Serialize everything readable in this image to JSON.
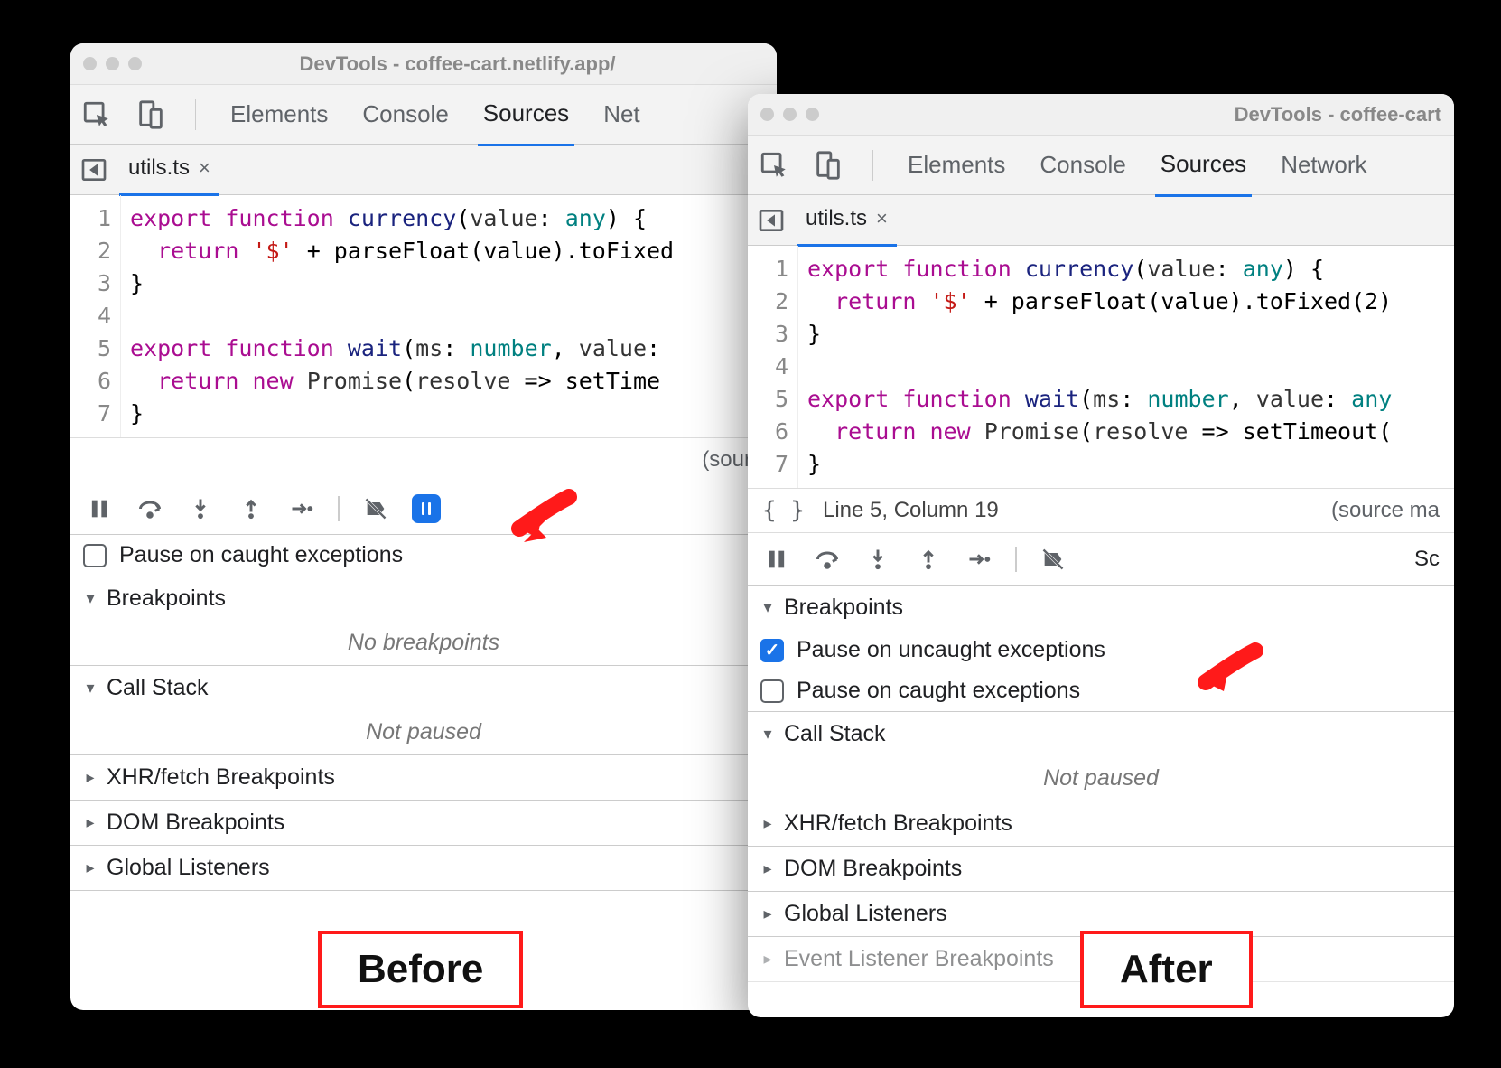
{
  "before": {
    "title": "DevTools - coffee-cart.netlify.app/",
    "tabs": {
      "elements": "Elements",
      "console": "Console",
      "sources": "Sources",
      "network": "Net"
    },
    "file": "utils.ts",
    "code": {
      "l1": {
        "kw1": "export",
        "kw2": "function",
        "fn": "currency",
        "arg": "value",
        "ty": "any",
        "tail": ") {"
      },
      "l2": {
        "kw": "return",
        "str": "'$'",
        "rest": " + parseFloat(value).toFixed"
      },
      "l3": "}",
      "l5": {
        "kw1": "export",
        "kw2": "function",
        "fn": "wait",
        "arg1": "ms",
        "ty1": "number",
        "arg2": "value",
        "tail": ":"
      },
      "l6": {
        "kw1": "return",
        "kw2": "new",
        "cls": "Promise",
        "arg": "resolve",
        "arrow": " => ",
        "call": "setTime"
      },
      "l7": "}"
    },
    "sourcemap": "(sourc",
    "pause_caught": "Pause on caught exceptions",
    "sections": {
      "breakpoints": "Breakpoints",
      "no_breakpoints": "No breakpoints",
      "callstack": "Call Stack",
      "not_paused": "Not paused",
      "xhr": "XHR/fetch Breakpoints",
      "dom": "DOM Breakpoints",
      "global": "Global Listeners"
    },
    "label": "Before"
  },
  "after": {
    "title": "DevTools - coffee-cart",
    "tabs": {
      "elements": "Elements",
      "console": "Console",
      "sources": "Sources",
      "network": "Network"
    },
    "file": "utils.ts",
    "code": {
      "l1": {
        "kw1": "export",
        "kw2": "function",
        "fn": "currency",
        "arg": "value",
        "ty": "any",
        "tail": ") {"
      },
      "l2": {
        "kw": "return",
        "str": "'$'",
        "rest": " + parseFloat(value).toFixed(2)"
      },
      "l3": "}",
      "l5": {
        "kw1": "export",
        "kw2": "function",
        "fn": "wait",
        "arg1": "ms",
        "ty1": "number",
        "arg2": "value",
        "ty2": "any"
      },
      "l6": {
        "kw1": "return",
        "kw2": "new",
        "cls": "Promise",
        "arg": "resolve",
        "arrow": " => ",
        "call": "setTimeout("
      },
      "l7": "}"
    },
    "status_cursor": "Line 5, Column 19",
    "sourcemap": "(source ma",
    "scope_tab": "Sc",
    "pause_uncaught": "Pause on uncaught exceptions",
    "pause_caught": "Pause on caught exceptions",
    "sections": {
      "breakpoints": "Breakpoints",
      "callstack": "Call Stack",
      "not_paused": "Not paused",
      "xhr": "XHR/fetch Breakpoints",
      "dom": "DOM Breakpoints",
      "global": "Global Listeners",
      "event": "Event Listener Breakpoints"
    },
    "label": "After"
  }
}
